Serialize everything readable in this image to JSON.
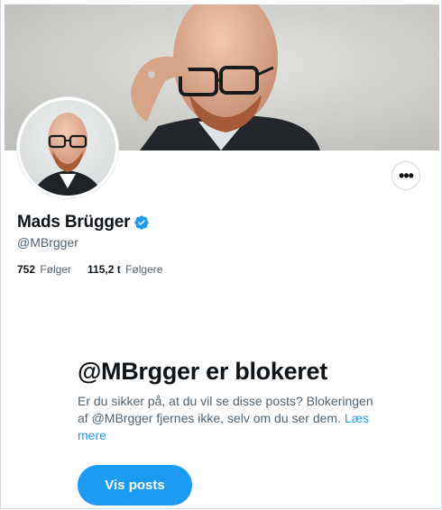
{
  "profile": {
    "display_name": "Mads Brügger",
    "handle": "@MBrgger",
    "verified": true,
    "banner_image": "portrait-photo-bald-man-glasses",
    "avatar_image": "portrait-photo-bald-man-glasses-beard"
  },
  "actions": {
    "more_label": "•••",
    "more_icon": "more-horizontal-icon"
  },
  "stats": {
    "following_count": "752",
    "following_label": "Følger",
    "followers_count": "115,2 t",
    "followers_label": "Følgere"
  },
  "blocked": {
    "title": "@MBrgger er blokeret",
    "text": "Er du sikker på, at du vil se disse posts? Blokeringen af @MBrgger fjernes ikke, selv om du ser dem.",
    "learn_more": "Læs mere",
    "button_label": "Vis posts"
  },
  "colors": {
    "accent": "#1d9bf0",
    "text_primary": "#0f1419",
    "text_secondary": "#536471",
    "border": "#cfd9de"
  }
}
